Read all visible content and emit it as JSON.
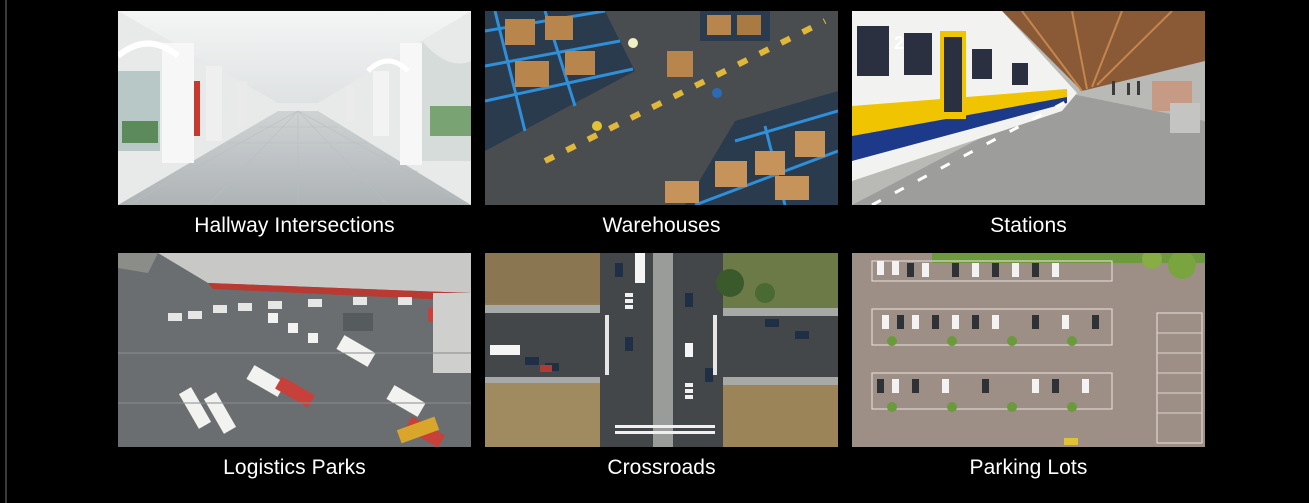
{
  "gallery": {
    "items": [
      {
        "label": "Hallway Intersections",
        "image": "hallway-photo"
      },
      {
        "label": "Warehouses",
        "image": "warehouse-photo"
      },
      {
        "label": "Stations",
        "image": "station-photo"
      },
      {
        "label": "Logistics Parks",
        "image": "logistics-park-photo"
      },
      {
        "label": "Crossroads",
        "image": "crossroads-photo"
      },
      {
        "label": "Parking Lots",
        "image": "parking-lot-photo"
      }
    ]
  },
  "colors": {
    "background": "#000000",
    "caption_text": "#ffffff"
  }
}
